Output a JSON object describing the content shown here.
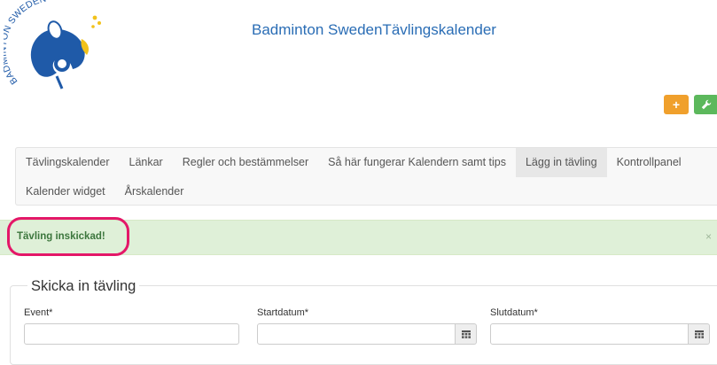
{
  "header": {
    "logo_text": "BADMINTON SWEDEN",
    "site_title": "Badminton SwedenTävlingskalender"
  },
  "actions": {
    "add_glyph": "+",
    "settings_icon": "wrench-icon"
  },
  "nav": {
    "items": [
      {
        "label": "Tävlingskalender",
        "active": false
      },
      {
        "label": "Länkar",
        "active": false
      },
      {
        "label": "Regler och bestämmelser",
        "active": false
      },
      {
        "label": "Så här fungerar Kalendern samt tips",
        "active": false
      },
      {
        "label": "Lägg in tävling",
        "active": true
      },
      {
        "label": "Kontrollpanel",
        "active": false
      },
      {
        "label": "Kalender widget",
        "active": false
      },
      {
        "label": "Årskalender",
        "active": false
      }
    ]
  },
  "alert": {
    "message": "Tävling inskickad!",
    "close": "×"
  },
  "form": {
    "legend": "Skicka in tävling",
    "fields": {
      "event": {
        "label": "Event*",
        "value": ""
      },
      "start": {
        "label": "Startdatum*",
        "value": ""
      },
      "end": {
        "label": "Slutdatum*",
        "value": ""
      }
    }
  },
  "colors": {
    "title_blue": "#2a6db5",
    "logo_blue": "#1f5aa8",
    "logo_yellow": "#f2c21b",
    "add_orange": "#f0a02c",
    "settings_green": "#5cb85c",
    "alert_bg": "#dff0d8",
    "alert_text": "#3c763d",
    "highlight": "#e41768"
  }
}
